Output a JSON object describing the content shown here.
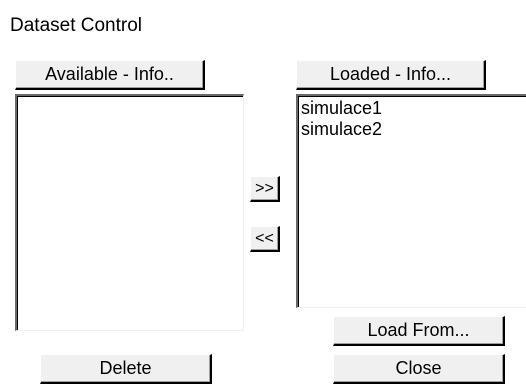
{
  "window": {
    "title": "Dataset Control"
  },
  "available": {
    "header_label": "Available - Info..",
    "items": []
  },
  "loaded": {
    "header_label": "Loaded - Info...",
    "items": [
      {
        "label": "simulace1"
      },
      {
        "label": "simulace2"
      }
    ]
  },
  "transfer": {
    "move_right_label": ">>",
    "move_left_label": "<<"
  },
  "actions": {
    "load_from_label": "Load From...",
    "delete_label": "Delete",
    "close_label": "Close"
  }
}
